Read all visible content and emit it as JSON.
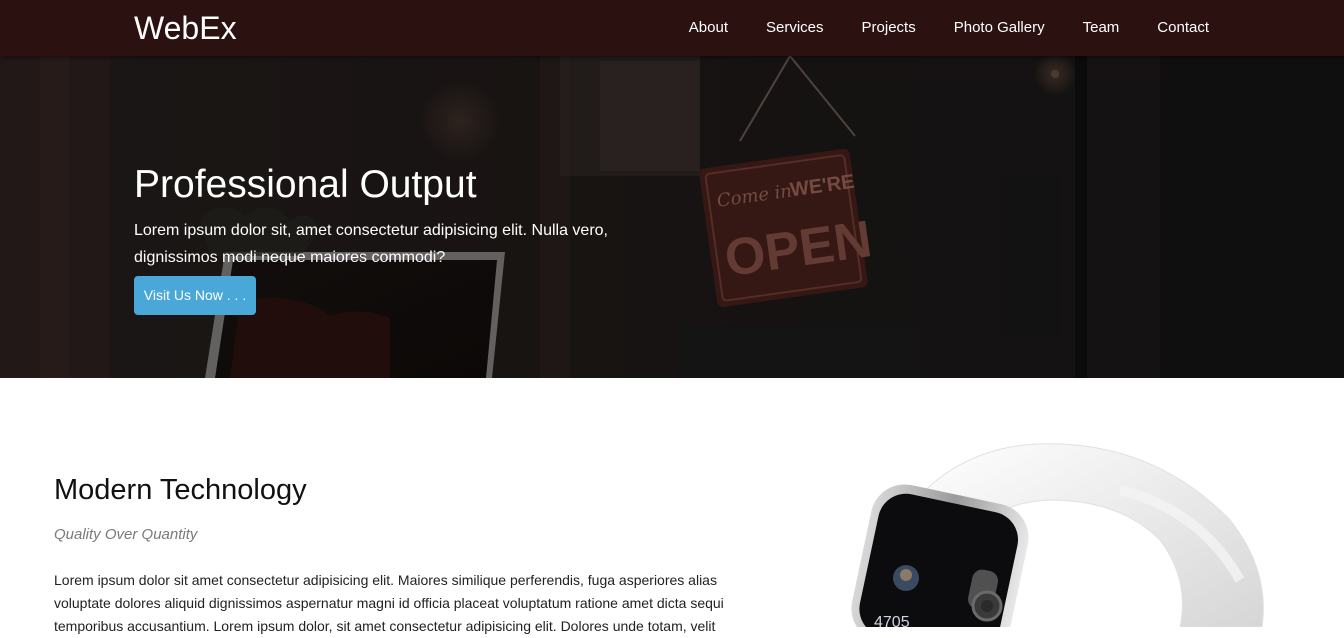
{
  "navbar": {
    "brand": "WebEx",
    "links": [
      {
        "label": "About"
      },
      {
        "label": "Services"
      },
      {
        "label": "Projects"
      },
      {
        "label": "Photo Gallery"
      },
      {
        "label": "Team"
      },
      {
        "label": "Contact"
      }
    ]
  },
  "hero": {
    "title": "Professional Output",
    "text": "Lorem ipsum dolor sit, amet consectetur adipisicing elit. Nulla vero, dignissimos modi neque maiores commodi?",
    "button_label": "Visit Us Now . . .",
    "sign_script": "Come in",
    "sign_line1": "WE'RE",
    "sign_line2": "OPEN"
  },
  "feature": {
    "title": "Modern Technology",
    "subtitle": "Quality Over Quantity",
    "body": "Lorem ipsum dolor sit amet consectetur adipisicing elit. Maiores similique perferendis, fuga asperiores alias voluptate dolores aliquid dignissimos aspernatur magni id officia placeat voluptatum ratione amet dicta sequi temporibus accusantium. Lorem ipsum dolor, sit amet consectetur adipisicing elit. Dolores unde totam, velit",
    "watch_display": "4705"
  },
  "colors": {
    "navbar_bg": "#2b110f",
    "button_bg": "#4aa8d8",
    "subtitle_text": "#7a7a7a"
  }
}
